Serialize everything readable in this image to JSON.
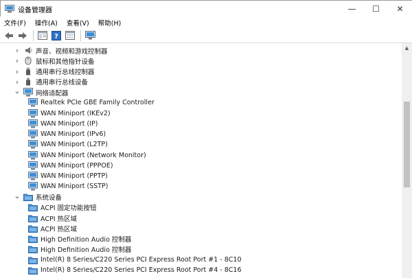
{
  "window": {
    "title": "设备管理器",
    "minimize_glyph": "—",
    "maximize_glyph": "☐",
    "close_glyph": "✕"
  },
  "menu": [
    "文件(F)",
    "操作(A)",
    "查看(V)",
    "帮助(H)"
  ],
  "toolbar": [
    "back-icon",
    "forward-icon",
    "properties-window-icon",
    "help-icon",
    "view-icon",
    "monitor-icon"
  ],
  "tree": [
    {
      "label": "声音、视频和游戏控制器",
      "icon": "speaker-icon",
      "level": 1,
      "expander": "collapsed"
    },
    {
      "label": "鼠标和其他指针设备",
      "icon": "mouse-icon",
      "level": 1,
      "expander": "collapsed"
    },
    {
      "label": "通用串行总线控制器",
      "icon": "usb-icon",
      "level": 1,
      "expander": "collapsed"
    },
    {
      "label": "通用串行总线设备",
      "icon": "usb-icon",
      "level": 1,
      "expander": "collapsed"
    },
    {
      "label": "网络适配器",
      "icon": "network-adapter-icon",
      "level": 1,
      "expander": "expanded"
    },
    {
      "label": "Realtek PCIe GBE Family Controller",
      "icon": "network-adapter-icon",
      "level": 2
    },
    {
      "label": "WAN Miniport (IKEv2)",
      "icon": "network-adapter-icon",
      "level": 2
    },
    {
      "label": "WAN Miniport (IP)",
      "icon": "network-adapter-icon",
      "level": 2
    },
    {
      "label": "WAN Miniport (IPv6)",
      "icon": "network-adapter-icon",
      "level": 2
    },
    {
      "label": "WAN Miniport (L2TP)",
      "icon": "network-adapter-icon",
      "level": 2
    },
    {
      "label": "WAN Miniport (Network Monitor)",
      "icon": "network-adapter-icon",
      "level": 2
    },
    {
      "label": "WAN Miniport (PPPOE)",
      "icon": "network-adapter-icon",
      "level": 2
    },
    {
      "label": "WAN Miniport (PPTP)",
      "icon": "network-adapter-icon",
      "level": 2
    },
    {
      "label": "WAN Miniport (SSTP)",
      "icon": "network-adapter-icon",
      "level": 2
    },
    {
      "label": "系统设备",
      "icon": "system-device-icon",
      "level": 1,
      "expander": "expanded"
    },
    {
      "label": "ACPI 固定功能按钮",
      "icon": "system-device-icon",
      "level": 2
    },
    {
      "label": "ACPI 热区域",
      "icon": "system-device-icon",
      "level": 2
    },
    {
      "label": "ACPI 热区域",
      "icon": "system-device-icon",
      "level": 2
    },
    {
      "label": "High Definition Audio 控制器",
      "icon": "system-device-icon",
      "level": 2
    },
    {
      "label": "High Definition Audio 控制器",
      "icon": "system-device-icon",
      "level": 2
    },
    {
      "label": "Intel(R) 8 Series/C220 Series PCI Express Root Port #1 - 8C10",
      "icon": "system-device-icon",
      "level": 2
    },
    {
      "label": "Intel(R) 8 Series/C220 Series PCI Express Root Port #4 - 8C16",
      "icon": "system-device-icon",
      "level": 2
    }
  ],
  "colors": {
    "monitor_blue": "#3c8fd6",
    "folder_blue": "#4a90d2",
    "text": "#1a1a1a"
  }
}
